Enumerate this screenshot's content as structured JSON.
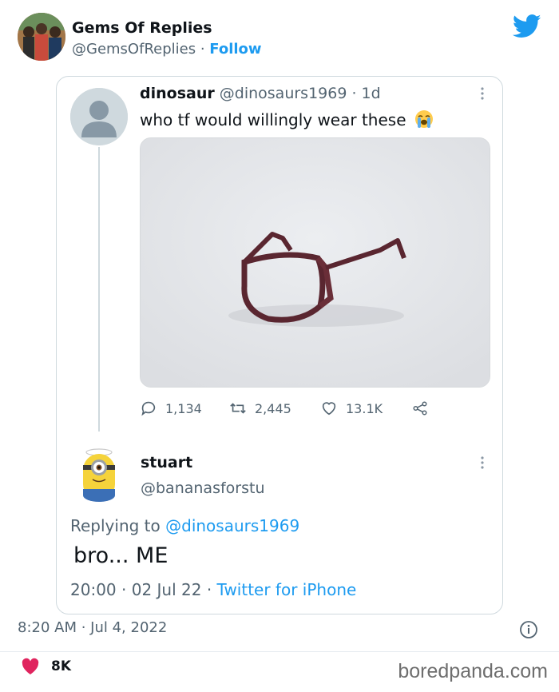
{
  "outer_tweet": {
    "display_name": "Gems Of Replies",
    "handle": "@GemsOfReplies",
    "separator": " · ",
    "follow_label": "Follow",
    "timestamp": "8:20 AM · Jul 4, 2022",
    "likes": "8K"
  },
  "quoted_tweet": {
    "display_name": "dinosaur",
    "handle": "@dinosaurs1969",
    "age": " · 1d",
    "text": "who tf would willingly wear these",
    "emoji": "loudly-crying-face-emoji",
    "media_description": "tortoise-shell glasses frame on grey background",
    "replies": "1,134",
    "retweets": "2,445",
    "likes": "13.1K"
  },
  "reply_tweet": {
    "display_name": "stuart",
    "handle": "@bananasforstu",
    "replying_to_label": "Replying to ",
    "replying_to_handle": "@dinosaurs1969",
    "text": "bro... ME",
    "time": "20:00",
    "date": "02 Jul 22",
    "source": "Twitter for iPhone"
  },
  "watermark": "boredpanda.com",
  "colors": {
    "accent": "#1d9bf0",
    "muted": "#536471",
    "border": "#cfd9de",
    "like_red": "#e0245e"
  }
}
